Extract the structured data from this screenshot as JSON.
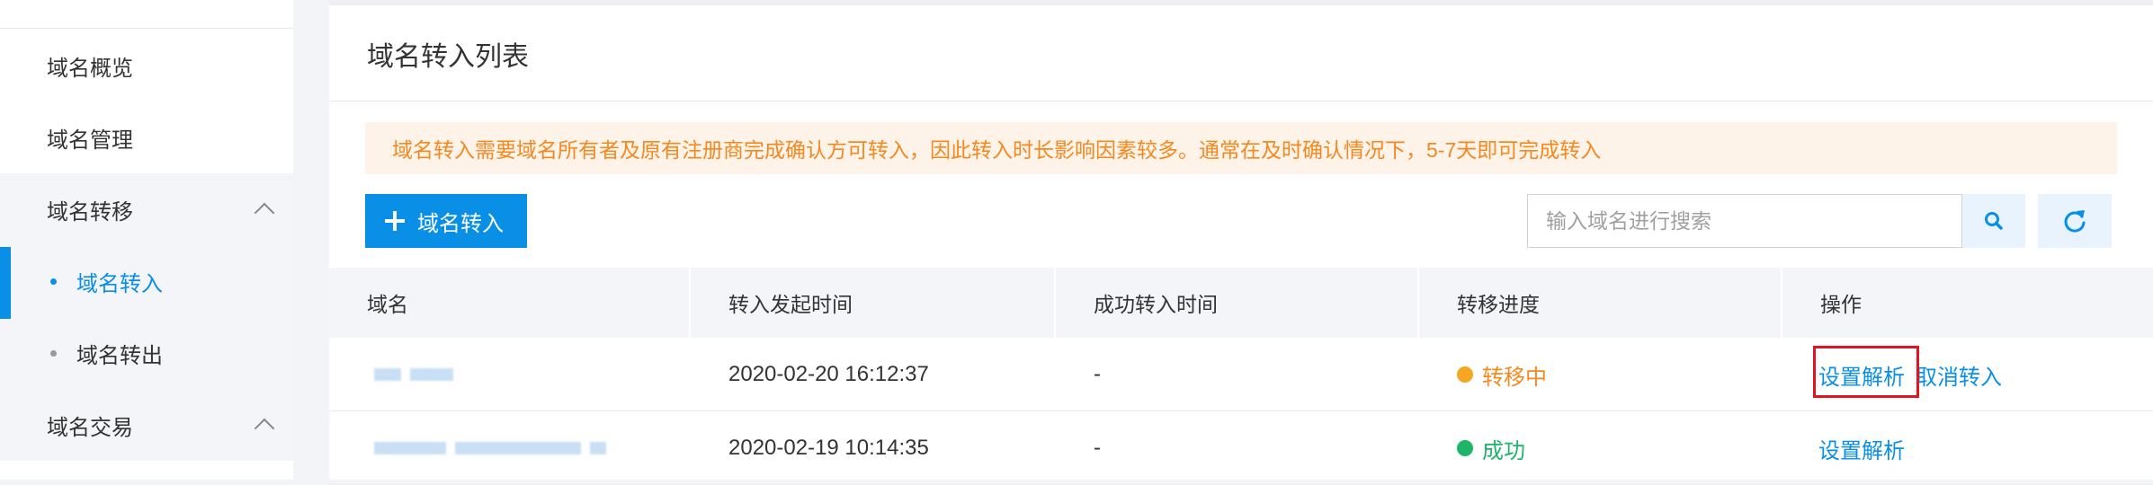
{
  "sidebar": {
    "items": [
      {
        "label": "域名概览"
      },
      {
        "label": "域名管理"
      },
      {
        "label": "域名转移"
      },
      {
        "label": "域名转入"
      },
      {
        "label": "域名转出"
      },
      {
        "label": "域名交易"
      }
    ]
  },
  "main": {
    "title": "域名转入列表",
    "notice": "域名转入需要域名所有者及原有注册商完成确认方可转入，因此转入时长影响因素较多。通常在及时确认情况下，5-7天即可完成转入",
    "add_button_label": "域名转入",
    "search": {
      "placeholder": "输入域名进行搜索",
      "value": ""
    },
    "table": {
      "headers": [
        "域名",
        "转入发起时间",
        "成功转入时间",
        "转移进度",
        "操作"
      ],
      "rows": [
        {
          "start_time": "2020-02-20 16:12:37",
          "success_time": "-",
          "status": "转移中",
          "status_color": "#f5a623",
          "status_text_color": "#f5881f",
          "actions": [
            "设置解析",
            "取消转入"
          ]
        },
        {
          "start_time": "2020-02-19 10:14:35",
          "success_time": "-",
          "status": "成功",
          "status_color": "#1eb46a",
          "status_text_color": "#1eb46a",
          "actions": [
            "设置解析"
          ]
        }
      ]
    }
  },
  "colors": {
    "accent": "#0a8fe6",
    "warning": "#f5881f",
    "success": "#1eb46a",
    "highlight": "#e3131f"
  },
  "icons": {
    "add": "plus-icon",
    "search": "search-icon",
    "refresh": "refresh-icon",
    "collapse": "chevron-up-icon"
  }
}
